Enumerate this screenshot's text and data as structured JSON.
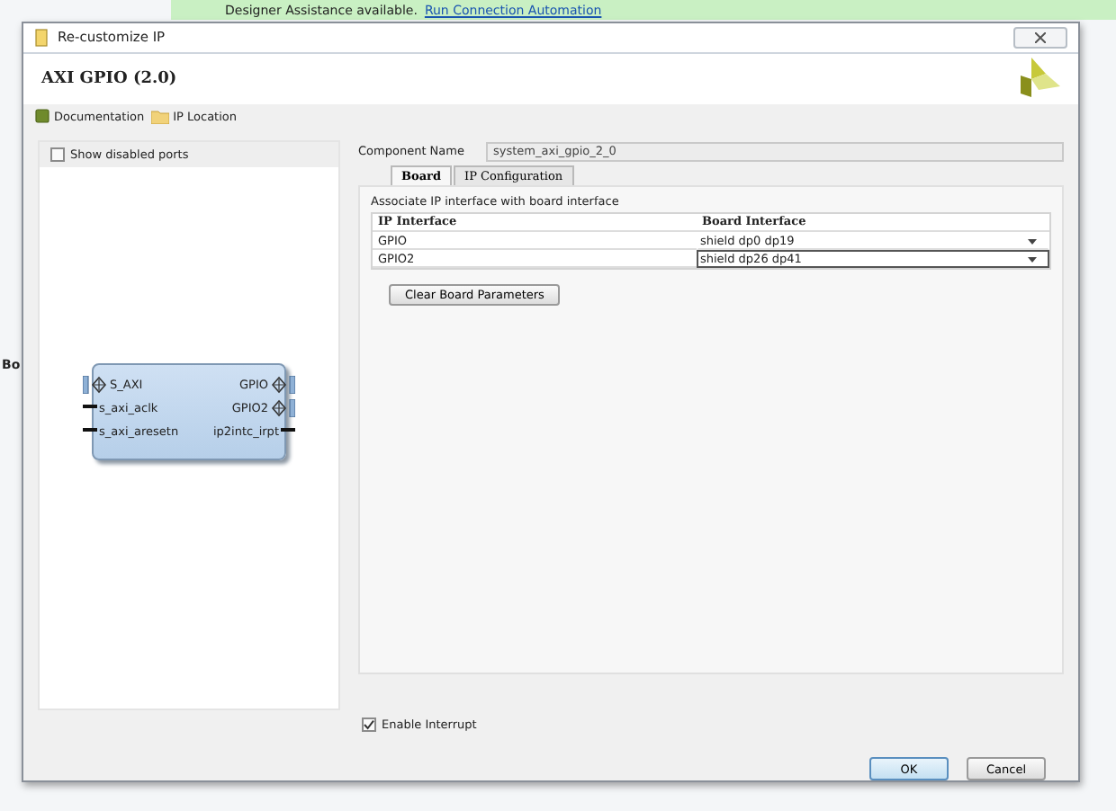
{
  "background": {
    "assistance": "Designer Assistance available.",
    "link": "Run Connection Automation",
    "side_label": "Bo"
  },
  "window": {
    "title": "Re-customize IP",
    "heading": "AXI GPIO (2.0)"
  },
  "toolbar": [
    "Documentation",
    "IP Location"
  ],
  "show_disabled_ports": {
    "label": "Show disabled ports",
    "checked": false
  },
  "diagram": {
    "left_ports": [
      {
        "name": "S_AXI",
        "kind": "bus"
      },
      {
        "name": "s_axi_aclk",
        "kind": "wire"
      },
      {
        "name": "s_axi_aresetn",
        "kind": "wire"
      }
    ],
    "right_ports": [
      {
        "name": "GPIO",
        "kind": "bus"
      },
      {
        "name": "GPIO2",
        "kind": "bus"
      },
      {
        "name": "ip2intc_irpt",
        "kind": "wire"
      }
    ]
  },
  "component_name": {
    "label": "Component Name",
    "value": "system_axi_gpio_2_0"
  },
  "tabs": [
    {
      "label": "Board",
      "selected": true
    },
    {
      "label": "IP Configuration",
      "selected": false
    }
  ],
  "board": {
    "caption": "Associate IP interface with board interface",
    "columns": [
      "IP Interface",
      "Board Interface"
    ],
    "rows": [
      {
        "ip_interface": "GPIO",
        "board_interface": "shield dp0 dp19",
        "selected": false
      },
      {
        "ip_interface": "GPIO2",
        "board_interface": "shield dp26 dp41",
        "selected": true
      }
    ],
    "clear_button": "Clear Board Parameters"
  },
  "enable_interrupt": {
    "label": "Enable Interrupt",
    "checked": true
  },
  "buttons": [
    "OK",
    "Cancel"
  ]
}
